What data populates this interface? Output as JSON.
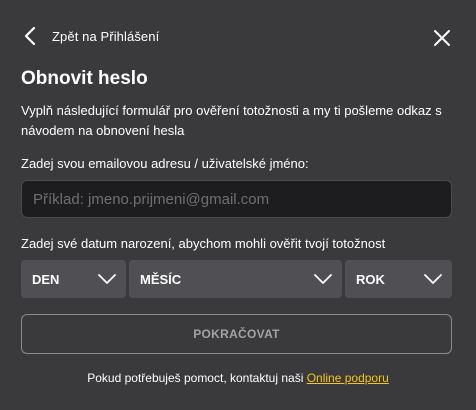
{
  "header": {
    "back_label": "Zpět na Přihlášení",
    "back_icon": "chevron-left-icon",
    "close_icon": "close-icon"
  },
  "form": {
    "title": "Obnovit heslo",
    "description": "Vyplň následující formulář pro ověření totožnosti a my ti pošleme odkaz s návodem na obnovení hesla",
    "email_label": "Zadej svou emailovou adresu / uživatelské jméno:",
    "email_value": "",
    "email_placeholder": "Příklad: jmeno.prijmeni@gmail.com",
    "birth_label": "Zadej své datum narození, abychom mohli ověřit tvojí totožnost",
    "day_value": "DEN",
    "month_value": "MĚSÍC",
    "year_value": "ROK",
    "select_icon": "chevron-down-icon",
    "submit_label": "POKRAČOVAT"
  },
  "help": {
    "text": "Pokud potřebuješ pomoct, kontaktuj naši",
    "link_label": "Online podporu"
  },
  "colors": {
    "background": "#3a3a3c",
    "input_background": "#1d1d1f",
    "select_background": "#505054",
    "link": "#f5c518",
    "button_border": "#8a8a8d",
    "button_text": "#a3a3a6"
  }
}
